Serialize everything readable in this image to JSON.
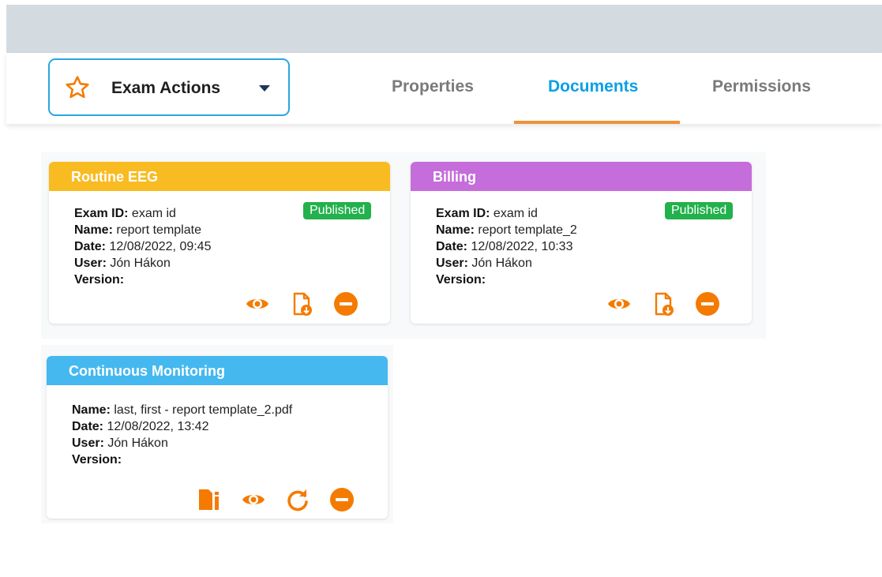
{
  "header": {
    "actions_label": "Exam Actions",
    "tabs": [
      {
        "label": "Properties",
        "active": false
      },
      {
        "label": "Documents",
        "active": true
      },
      {
        "label": "Permissions",
        "active": false
      }
    ]
  },
  "colors": {
    "accent_blue": "#0aa0e6",
    "tab_underline": "#f0913a",
    "icon_orange": "#f47b00",
    "badge_green": "#22b14c",
    "card_yellow": "#f8bb22",
    "card_purple": "#c46ddb",
    "card_blue": "#45b8f0"
  },
  "cards": [
    {
      "title": "Routine EEG",
      "badge": "Published",
      "fields": [
        {
          "label": "Exam ID:",
          "value": "exam id"
        },
        {
          "label": "Name:",
          "value": "report template"
        },
        {
          "label": "Date:",
          "value": "12/08/2022, 09:45"
        },
        {
          "label": "User:",
          "value": "Jón Hákon"
        },
        {
          "label": "Version:",
          "value": ""
        }
      ],
      "icons": [
        "eye-icon",
        "file-download-icon",
        "minus-circle-icon"
      ]
    },
    {
      "title": "Billing",
      "badge": "Published",
      "fields": [
        {
          "label": "Exam ID:",
          "value": "exam id"
        },
        {
          "label": "Name:",
          "value": "report template_2"
        },
        {
          "label": "Date:",
          "value": "12/08/2022, 10:33"
        },
        {
          "label": "User:",
          "value": "Jón Hákon"
        },
        {
          "label": "Version:",
          "value": ""
        }
      ],
      "icons": [
        "eye-icon",
        "file-download-icon",
        "minus-circle-icon"
      ]
    },
    {
      "title": "Continuous Monitoring",
      "fields": [
        {
          "label": "Name:",
          "value": "last, first - report template_2.pdf"
        },
        {
          "label": "Date:",
          "value": "12/08/2022, 13:42"
        },
        {
          "label": "User:",
          "value": "Jón Hákon"
        },
        {
          "label": "Version:",
          "value": ""
        }
      ],
      "icons": [
        "file-info-icon",
        "eye-icon",
        "refresh-icon",
        "minus-circle-icon"
      ]
    }
  ]
}
